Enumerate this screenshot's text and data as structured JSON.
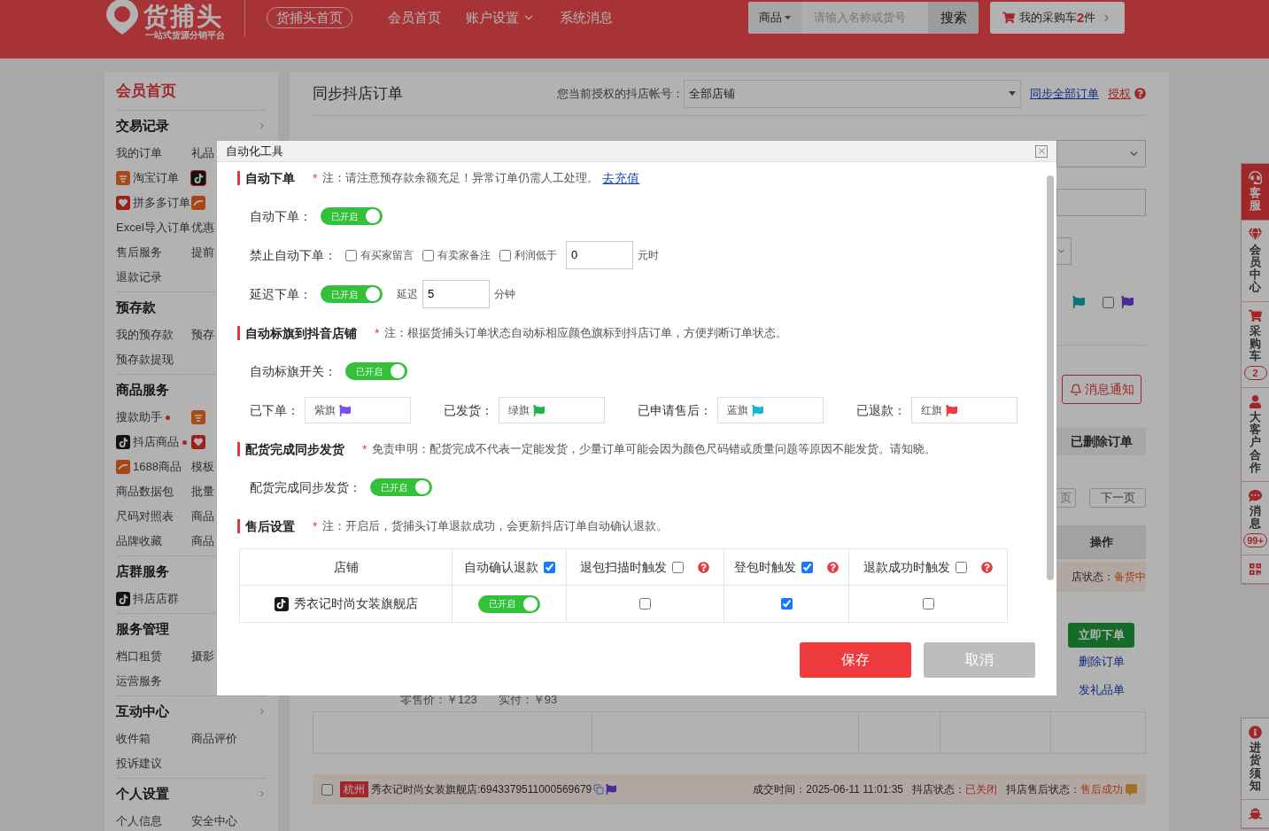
{
  "header": {
    "logo_title": "货捕头",
    "logo_subtitle": "一站式货源分销平台",
    "nav": [
      {
        "label": "货捕头首页",
        "kind": "pill",
        "dropdown": false
      },
      {
        "label": "会员首页",
        "kind": "link",
        "dropdown": false
      },
      {
        "label": "账户设置",
        "kind": "link",
        "dropdown": true
      },
      {
        "label": "系统消息",
        "kind": "link",
        "dropdown": false
      }
    ],
    "search": {
      "category": "商品",
      "placeholder": "请输入名称或货号",
      "button": "搜索"
    },
    "cart": {
      "label": "我的采购车",
      "count": "2",
      "unit": "件"
    }
  },
  "sidebar": {
    "title": "会员首页",
    "sections": [
      {
        "title": "交易记录",
        "arrow": true,
        "items": [
          {
            "label": "我的订单",
            "kind": "text",
            "selected": false
          },
          {
            "label": "礼品",
            "kind": "text",
            "selected": false
          },
          {
            "label": "淘宝订单",
            "kind": "taobao",
            "selected": false
          },
          {
            "kind": "douyin",
            "selected": true
          },
          {
            "label": "拼多多订单",
            "kind": "pdd",
            "selected": false
          },
          {
            "kind": "ali1688",
            "selected": false
          },
          {
            "label": "Excel导入订单",
            "kind": "text",
            "selected": false
          },
          {
            "label": "优惠",
            "kind": "text",
            "selected": false
          },
          {
            "label": "售后服务",
            "kind": "text",
            "selected": false
          },
          {
            "label": "提前",
            "kind": "text",
            "selected": false
          },
          {
            "label": "退款记录",
            "kind": "text",
            "selected": false
          }
        ]
      },
      {
        "title": "预存款",
        "arrow": false,
        "items": [
          {
            "label": "我的预存款",
            "kind": "text",
            "selected": false
          },
          {
            "label": "预存",
            "kind": "text",
            "selected": false
          },
          {
            "label": "预存款提现",
            "kind": "text",
            "selected": false
          }
        ]
      },
      {
        "title": "商品服务",
        "arrow": false,
        "items": [
          {
            "label": "搜款助手",
            "kind": "text",
            "selected": false,
            "dot": true
          },
          {
            "kind": "taobao",
            "selected": false,
            "dot": false
          },
          {
            "label": "抖店商品",
            "kind": "douyin",
            "selected": false,
            "dot": true
          },
          {
            "kind": "pdd",
            "selected": false,
            "dot": false
          },
          {
            "label": "1688商品",
            "kind": "ali1688",
            "selected": false,
            "dot": false
          },
          {
            "label": "模板",
            "kind": "text",
            "selected": false,
            "dot": false
          },
          {
            "label": "商品数据包",
            "kind": "text",
            "selected": false,
            "dot": false
          },
          {
            "label": "批量",
            "kind": "text",
            "selected": false,
            "dot": false
          },
          {
            "label": "尺码对照表",
            "kind": "text",
            "selected": false,
            "dot": false
          },
          {
            "label": "商品",
            "kind": "text",
            "selected": false,
            "dot": false
          },
          {
            "label": "品牌收藏",
            "kind": "text",
            "selected": false,
            "dot": false
          },
          {
            "label": "商品",
            "kind": "text",
            "selected": false,
            "dot": false
          }
        ]
      },
      {
        "title": "店群服务",
        "arrow": false,
        "items": [
          {
            "label": "抖店店群",
            "kind": "douyin",
            "selected": false
          }
        ]
      },
      {
        "title": "服务管理",
        "arrow": false,
        "items": [
          {
            "label": "档口租赁",
            "kind": "text",
            "selected": false
          },
          {
            "label": "摄影",
            "kind": "text",
            "selected": false
          },
          {
            "label": "运营服务",
            "kind": "text",
            "selected": false
          }
        ]
      },
      {
        "title": "互动中心",
        "arrow": true,
        "items": [
          {
            "label": "收件箱",
            "kind": "text",
            "selected": false
          },
          {
            "label": "商品评价",
            "kind": "text",
            "selected": false
          },
          {
            "label": "投诉建议",
            "kind": "text",
            "selected": false
          }
        ]
      },
      {
        "title": "个人设置",
        "arrow": true,
        "items": [
          {
            "label": "个人信息",
            "kind": "text",
            "selected": false
          },
          {
            "label": "安全中心",
            "kind": "text",
            "selected": false
          }
        ]
      }
    ]
  },
  "main": {
    "title": "同步抖店订单",
    "account_label": "您当前授权的抖店帐号：",
    "account_select": "全部店铺",
    "links": [
      "同步全部订单",
      "授权"
    ],
    "filter_checked": false,
    "notify_button": "消息通知",
    "deleted_tab": "已删除订单",
    "pager": [
      "页",
      "下一页"
    ],
    "action_header": "操作",
    "order_status": {
      "label": "店状态：",
      "value": "备货中"
    },
    "actions": [
      {
        "label": "立即下单",
        "kind": "primary"
      },
      {
        "label": "删除订单",
        "kind": "link"
      },
      {
        "label": "发礼品单",
        "kind": "link"
      }
    ],
    "prices": [
      "零售价：￥123",
      "实付：￥93"
    ],
    "order": {
      "tag": "杭州",
      "store": "秀衣记时尚女装旗舰店:6943379511000569679",
      "checked": false,
      "time": "成交时间：2025-06-11 11:01:35",
      "status_label": "抖店状态：",
      "status": "已关闭",
      "after_label": "抖店售后状态：",
      "after": "售后成功"
    }
  },
  "float_bar": {
    "items": [
      {
        "label": "客服",
        "kind": "service",
        "selected": true
      },
      {
        "label": "会员中心",
        "kind": "member",
        "selected": false
      },
      {
        "label": "采购车",
        "kind": "cart",
        "selected": false,
        "badge": "2"
      },
      {
        "label": "大客户合作",
        "kind": "client",
        "selected": false
      },
      {
        "label": "消息",
        "kind": "message",
        "selected": false,
        "badge": "99+"
      },
      {
        "kind": "qr",
        "selected": false
      }
    ],
    "bottom": [
      {
        "label": "进货须知",
        "kind": "info"
      },
      {
        "kind": "boat"
      }
    ]
  },
  "modal": {
    "title": "自动化工具",
    "sections": [
      {
        "title": "自动下单",
        "note": {
          "mark": "*",
          "text": "注：请注意预存款余额充足！异常订单仍需人工处理。",
          "link": "去充值"
        },
        "rows": [
          {
            "kind": "switch",
            "label": "自动下单：",
            "switch": {
              "on": true,
              "text": "已开启"
            }
          },
          {
            "kind": "checks",
            "label": "禁止自动下单：",
            "options": [
              {
                "label": "有买家留言",
                "checked": false
              },
              {
                "label": "有卖家备注",
                "checked": false
              },
              {
                "label": "利润低于",
                "checked": false
              }
            ],
            "value": "0",
            "unit": "元时"
          },
          {
            "kind": "delay",
            "label": "延迟下单：",
            "switch": {
              "on": true,
              "text": "已开启"
            },
            "prefix": "延迟",
            "value": "5",
            "unit": "分钟"
          }
        ]
      },
      {
        "title": "自动标旗到抖音店铺",
        "note": {
          "mark": "*",
          "text": "注：根据货捕头订单状态自动标相应颜色旗标到抖店订单，方便判断订单状态。"
        },
        "rows": [
          {
            "kind": "switch",
            "label": "自动标旗开关：",
            "switch": {
              "on": true,
              "text": "已开启"
            }
          },
          {
            "kind": "flags",
            "items": [
              {
                "label": "已下单：",
                "value": "紫旗",
                "color": "#7b4cf0"
              },
              {
                "label": "已发货：",
                "value": "绿旗",
                "color": "#1fb64a"
              },
              {
                "label": "已申请售后：",
                "value": "蓝旗",
                "color": "#18b4d8"
              },
              {
                "label": "已退款：",
                "value": "红旗",
                "color": "#f0363c"
              }
            ]
          }
        ]
      },
      {
        "title": "配货完成同步发货",
        "note": {
          "mark": "*",
          "text": "免责申明：配货完成不代表一定能发货，少量订单可能会因为颜色尺码错或质量问题等原因不能发货。请知晓。"
        },
        "rows": [
          {
            "kind": "switch",
            "label": "配货完成同步发货：",
            "switch": {
              "on": true,
              "text": "已开启"
            }
          }
        ]
      },
      {
        "title": "售后设置",
        "note": {
          "mark": "*",
          "text": "注：开启后，货捕头订单退款成功，会更新抖店订单自动确认退款。"
        },
        "rows": [
          {
            "kind": "table",
            "columns": [
              {
                "label": "店铺",
                "kind": "text",
                "help": false
              },
              {
                "label": "自动确认退款",
                "kind": "check",
                "checked": true,
                "help": false
              },
              {
                "label": "退包扫描时触发",
                "kind": "check",
                "checked": false,
                "help": true
              },
              {
                "label": "登包时触发",
                "kind": "check",
                "checked": true,
                "help": true
              },
              {
                "label": "退款成功时触发",
                "kind": "check",
                "checked": false,
                "help": true
              }
            ],
            "rows": [
              {
                "store": "秀衣记时尚女装旗舰店",
                "switch": {
                  "on": true,
                  "text": "已开启"
                },
                "cells": [
                  {
                    "checked": false
                  },
                  {
                    "checked": true
                  },
                  {
                    "checked": false
                  }
                ]
              }
            ]
          }
        ]
      }
    ],
    "buttons": [
      {
        "label": "保存",
        "kind": "primary"
      },
      {
        "label": "取消",
        "kind": "secondary"
      }
    ]
  }
}
